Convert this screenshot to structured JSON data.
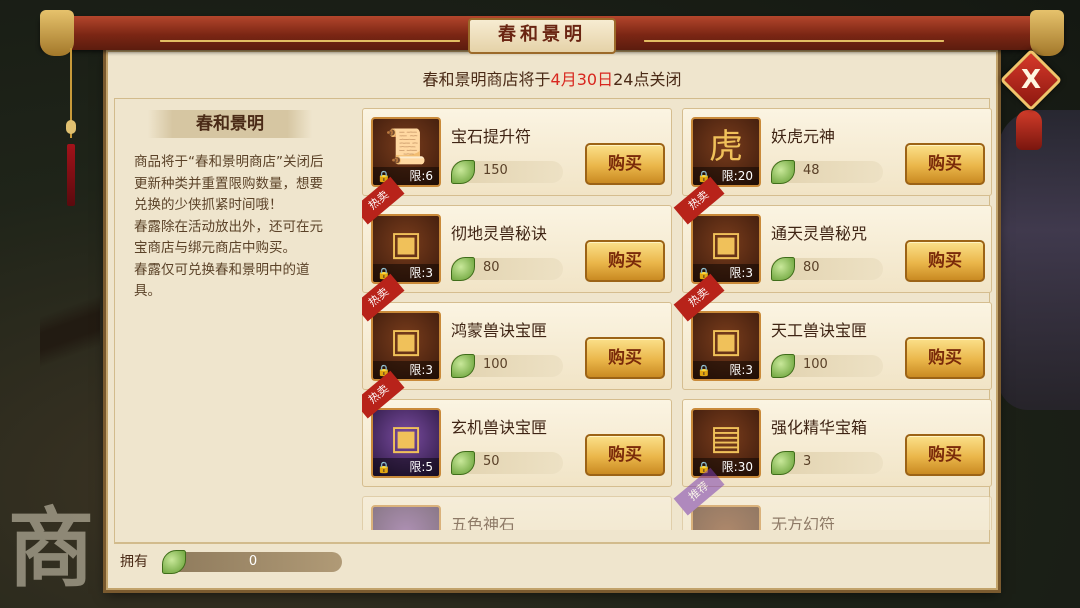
{
  "window": {
    "title": "春和景明",
    "close_label": "X"
  },
  "notice": {
    "prefix": "春和景明商店将于",
    "date": "4月30日",
    "suffix": "24点关闭"
  },
  "sidebar": {
    "title": "春和景明",
    "paragraphs": [
      "商品将于“春和景明商店”关闭后更新种类并重置限购数量，想要兑换的少侠抓紧时间哦！",
      "春露除在活动放出外，还可在元宝商店与绑元商店中购买。",
      "春露仅可兑换春和景明中的道具。"
    ]
  },
  "shop": {
    "buy_label": "购买",
    "currency_icon": "spring-dew-leaf-icon",
    "items": [
      {
        "name": "宝石提升符",
        "limit": "限:6",
        "price": "150",
        "badge": "",
        "icon": "scroll-icon",
        "glyph": "📜"
      },
      {
        "name": "妖虎元神",
        "limit": "限:20",
        "price": "48",
        "badge": "",
        "icon": "tiger-orb-icon",
        "glyph": "虎"
      },
      {
        "name": "彻地灵兽秘诀",
        "limit": "限:3",
        "price": "80",
        "badge": "热卖",
        "icon": "treasure-chest-icon",
        "glyph": "▣"
      },
      {
        "name": "通天灵兽秘咒",
        "limit": "限:3",
        "price": "80",
        "badge": "热卖",
        "icon": "treasure-chest-icon",
        "glyph": "▣"
      },
      {
        "name": "鸿蒙兽诀宝匣",
        "limit": "限:3",
        "price": "100",
        "badge": "热卖",
        "icon": "treasure-chest-icon",
        "glyph": "▣"
      },
      {
        "name": "天工兽诀宝匣",
        "limit": "限:3",
        "price": "100",
        "badge": "热卖",
        "icon": "treasure-chest-icon",
        "glyph": "▣"
      },
      {
        "name": "玄机兽诀宝匣",
        "limit": "限:5",
        "price": "50",
        "badge": "热卖",
        "icon": "purple-chest-icon",
        "glyph": "▣"
      },
      {
        "name": "强化精华宝箱",
        "limit": "限:30",
        "price": "3",
        "badge": "",
        "icon": "iron-chest-icon",
        "glyph": "▤"
      },
      {
        "name": "五色神石",
        "limit": "",
        "price": "",
        "badge": "",
        "icon": "stone-icon",
        "glyph": ""
      },
      {
        "name": "无方幻符",
        "limit": "",
        "price": "",
        "badge": "推荐",
        "icon": "talisman-icon",
        "glyph": ""
      }
    ]
  },
  "footer": {
    "own_label": "拥有",
    "own_value": "0"
  },
  "background": {
    "shop_glyph": "商"
  },
  "colors": {
    "accent_red": "#d8271f",
    "button_gold": "#eab64a",
    "panel_bg": "#efe5cd"
  }
}
